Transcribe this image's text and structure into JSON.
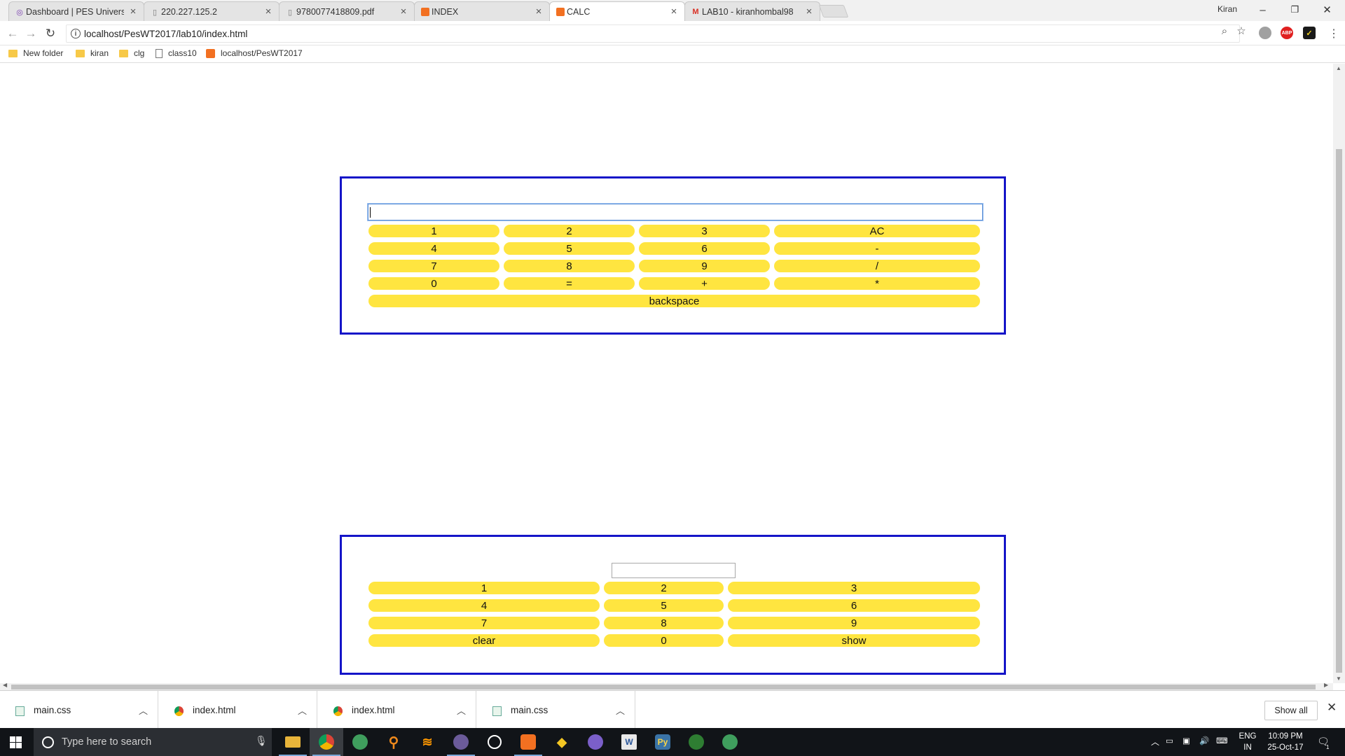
{
  "browser": {
    "tabs": [
      {
        "title": "Dashboard | PES Univers",
        "icon": "globe-icon",
        "active": false
      },
      {
        "title": "220.227.125.2",
        "icon": "page-icon",
        "active": false
      },
      {
        "title": "9780077418809.pdf",
        "icon": "page-icon",
        "active": false
      },
      {
        "title": "INDEX",
        "icon": "xampp-icon",
        "active": false
      },
      {
        "title": "CALC",
        "icon": "xampp-icon",
        "active": true
      },
      {
        "title": "LAB10 - kiranhombal98",
        "icon": "gmail-icon",
        "active": false
      }
    ],
    "profile_name": "Kiran",
    "window_controls": {
      "minimize": "–",
      "restore": "❐",
      "close": "✕"
    },
    "url": "localhost/PesWT2017/lab10/index.html",
    "extensions": {
      "abp": "ABP"
    },
    "bookmarks": [
      {
        "label": "New folder",
        "icon": "folder-icon"
      },
      {
        "label": "kiran",
        "icon": "folder-icon"
      },
      {
        "label": "clg",
        "icon": "folder-icon"
      },
      {
        "label": "class10",
        "icon": "page-icon"
      },
      {
        "label": "localhost/PesWT2017",
        "icon": "xampp-icon"
      }
    ]
  },
  "calculator_one": {
    "display_value": "",
    "keys": [
      [
        "1",
        "2",
        "3",
        "AC"
      ],
      [
        "4",
        "5",
        "6",
        "-"
      ],
      [
        "7",
        "8",
        "9",
        "/"
      ],
      [
        "0",
        "=",
        "+",
        "*"
      ]
    ],
    "backspace_label": "backspace"
  },
  "calculator_two": {
    "display_value": "",
    "keys": [
      [
        "1",
        "2",
        "3"
      ],
      [
        "4",
        "5",
        "6"
      ],
      [
        "7",
        "8",
        "9"
      ],
      [
        "clear",
        "0",
        "show"
      ]
    ]
  },
  "downloads": {
    "items": [
      {
        "name": "main.css",
        "icon": "css-file-icon"
      },
      {
        "name": "index.html",
        "icon": "chrome-file-icon"
      },
      {
        "name": "index.html",
        "icon": "chrome-file-icon"
      },
      {
        "name": "main.css",
        "icon": "css-file-icon"
      }
    ],
    "show_all_label": "Show all"
  },
  "taskbar": {
    "search_placeholder": "Type here to search",
    "apps": [
      "file-explorer-icon",
      "chrome-icon",
      "app-icon",
      "search-app-icon",
      "sublime-icon",
      "eclipse-icon",
      "obs-icon",
      "xampp-icon",
      "git-icon",
      "app-icon",
      "word-icon",
      "python-icon",
      "android-icon",
      "app-icon"
    ],
    "language": "ENG",
    "region": "IN",
    "time": "10:09 PM",
    "date": "25-Oct-17",
    "notification_count": "1"
  },
  "colors": {
    "box_border": "#1414c8",
    "key_fill": "#ffe540"
  }
}
